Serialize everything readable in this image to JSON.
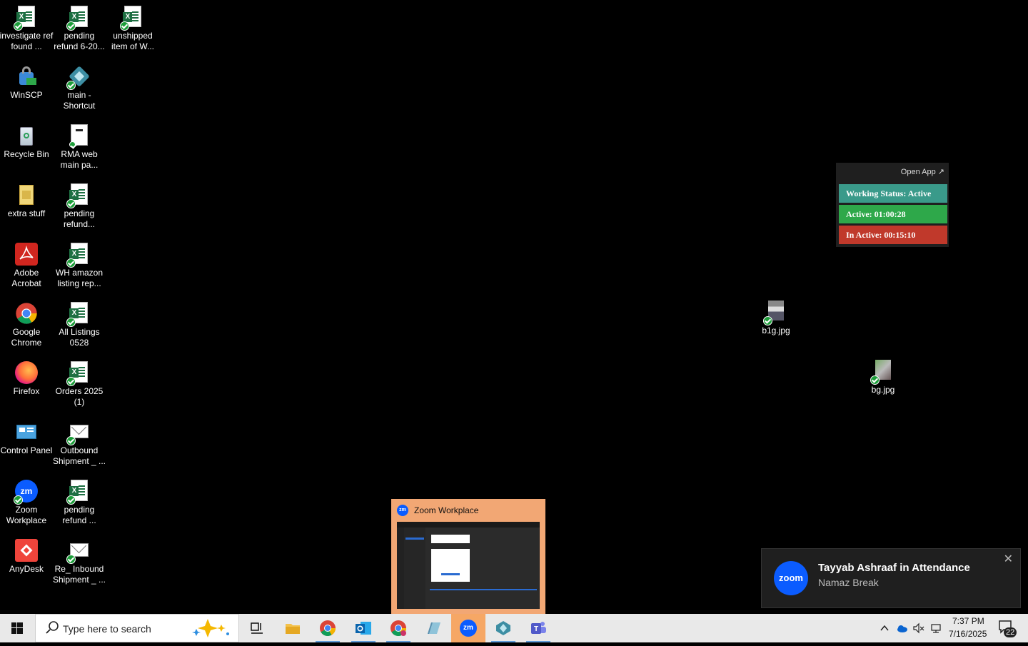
{
  "desktop": {
    "col1": [
      {
        "label": "investigate ref found ...",
        "icon": "excel-file-icon"
      },
      {
        "label": "WinSCP",
        "icon": "winscp-icon"
      },
      {
        "label": "Recycle Bin",
        "icon": "recycle-bin-icon"
      },
      {
        "label": "extra stuff",
        "icon": "folder-icon"
      },
      {
        "label": "Adobe Acrobat",
        "icon": "adobe-acrobat-icon"
      },
      {
        "label": "Google Chrome",
        "icon": "chrome-icon"
      },
      {
        "label": "Firefox",
        "icon": "firefox-icon"
      },
      {
        "label": "Control Panel",
        "icon": "control-panel-icon"
      },
      {
        "label": "Zoom Workplace",
        "icon": "zoom-icon"
      },
      {
        "label": "AnyDesk",
        "icon": "anydesk-icon"
      }
    ],
    "col2": [
      {
        "label": "pending refund 6-20...",
        "icon": "excel-file-icon"
      },
      {
        "label": "main - Shortcut",
        "icon": "shortcut-app-icon"
      },
      {
        "label": "RMA web main pa...",
        "icon": "web-file-icon"
      },
      {
        "label": "pending refund...",
        "icon": "excel-file-icon"
      },
      {
        "label": "WH amazon listing rep...",
        "icon": "excel-file-icon"
      },
      {
        "label": "All Listings 0528",
        "icon": "excel-file-icon"
      },
      {
        "label": "Orders 2025 (1)",
        "icon": "excel-file-icon"
      },
      {
        "label": "Outbound Shipment _ ...",
        "icon": "mail-file-icon"
      },
      {
        "label": "pending refund ...",
        "icon": "excel-file-icon"
      },
      {
        "label": "Re_ Inbound Shipment _ ...",
        "icon": "mail-file-icon"
      }
    ],
    "col3": [
      {
        "label": "unshipped item of W...",
        "icon": "excel-file-icon"
      }
    ],
    "images": [
      {
        "label": "b1g.jpg",
        "icon": "image-file-icon"
      },
      {
        "label": "bg.jpg",
        "icon": "image-file-icon"
      }
    ]
  },
  "status_widget": {
    "open_app": "Open App ↗",
    "working_status": "Working Status: Active",
    "active": "Active: 01:00:28",
    "inactive": "In Active: 00:15:10",
    "colors": {
      "status": "#3a9a8a",
      "active": "#2ea84a",
      "inactive": "#c0392b"
    }
  },
  "zoom_preview": {
    "title": "Zoom Workplace"
  },
  "notification": {
    "logo_text": "zoom",
    "title": "Tayyab Ashraaf in Attendance",
    "body": "Namaz Break",
    "close": "✕"
  },
  "taskbar": {
    "search_placeholder": "Type here to search",
    "apps": [
      "task-view",
      "file-explorer",
      "chrome",
      "outlook",
      "chrome-profile",
      "notepad",
      "zoom",
      "custom-app",
      "teams"
    ],
    "active_app": "zoom",
    "clock_time": "7:37 PM",
    "clock_date": "7/16/2025",
    "notification_count": "22"
  }
}
